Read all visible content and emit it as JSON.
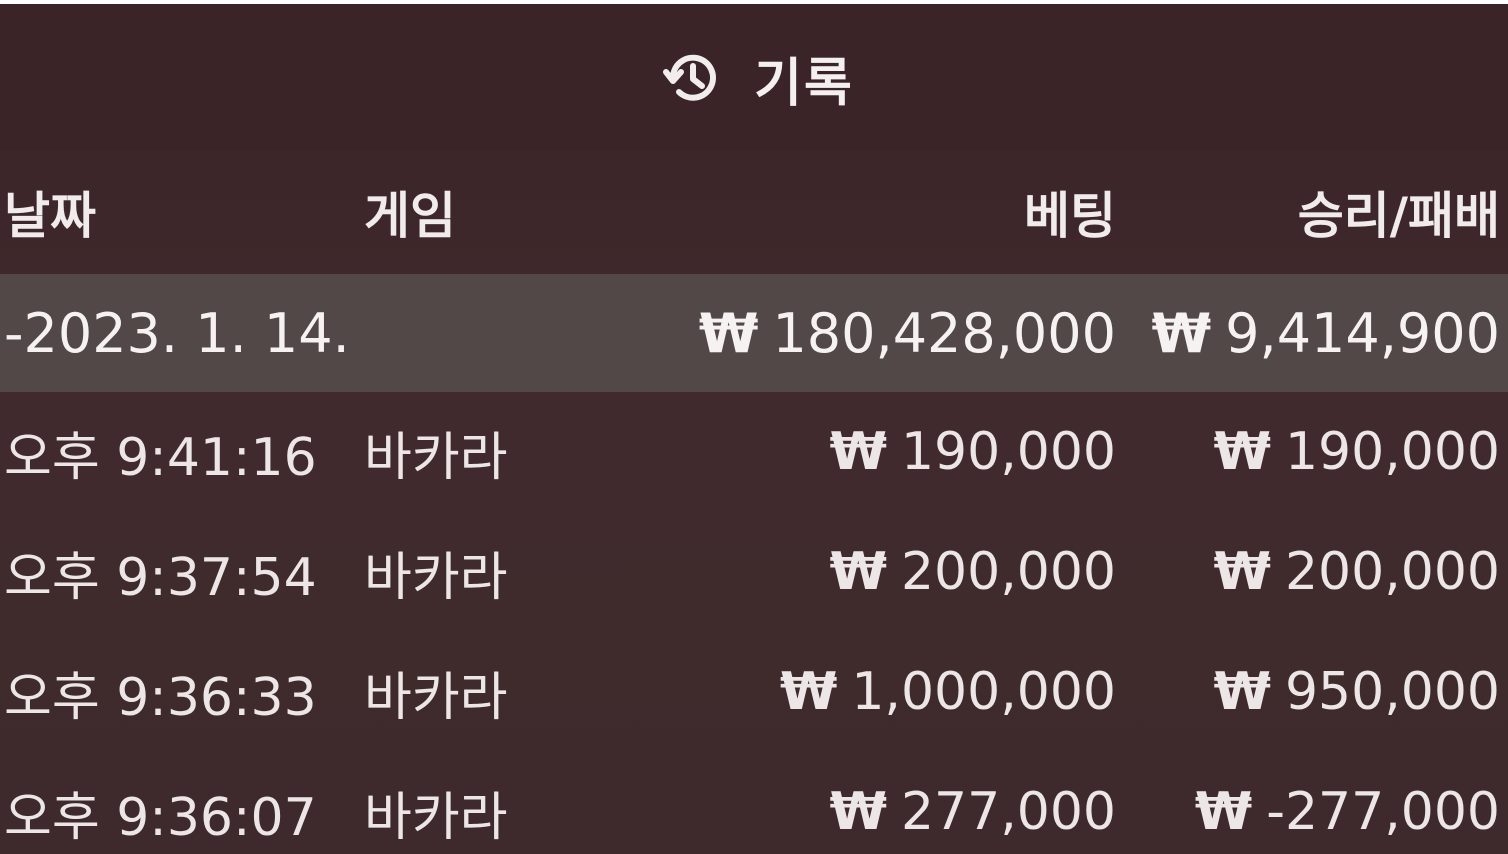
{
  "header": {
    "icon": "history-icon",
    "title": "기록"
  },
  "columns": {
    "date": "날짜",
    "game": "게임",
    "bet": "베팅",
    "result": "승리/패배"
  },
  "currency_symbol": "₩",
  "summary": {
    "date": "-2023. 1. 14.",
    "bet": "180,428,000",
    "result": "9,414,900"
  },
  "rows": [
    {
      "time": "오후 9:41:16",
      "game": "바카라",
      "bet": "190,000",
      "result": "190,000"
    },
    {
      "time": "오후 9:37:54",
      "game": "바카라",
      "bet": "200,000",
      "result": "200,000"
    },
    {
      "time": "오후 9:36:33",
      "game": "바카라",
      "bet": "1,000,000",
      "result": "950,000"
    },
    {
      "time": "오후 9:36:07",
      "game": "바카라",
      "bet": "277,000",
      "result": "-277,000"
    }
  ],
  "colors": {
    "background": "#3e2a2c",
    "header_bg": "#3a2427",
    "summary_row_bg": "#534848",
    "text": "#f3eeee"
  }
}
